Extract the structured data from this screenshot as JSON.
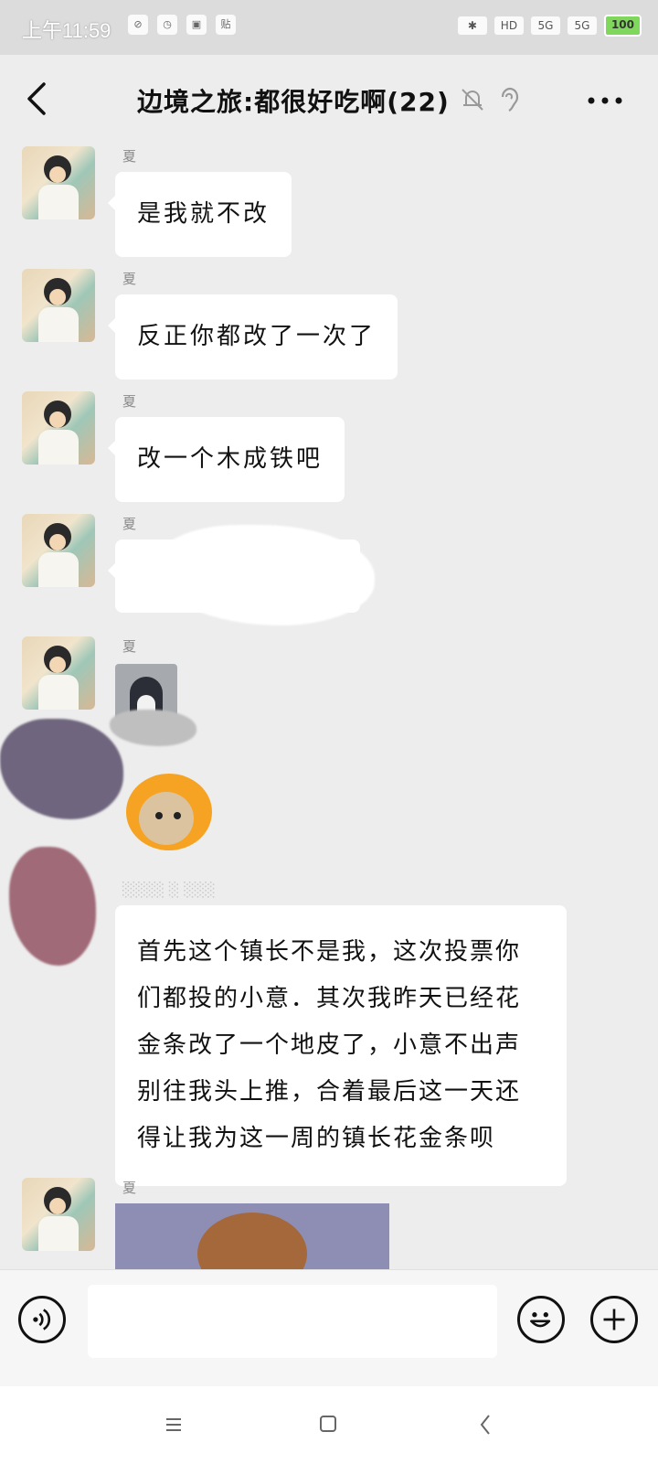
{
  "status_bar": {
    "time": "上午11:59",
    "left_icons": [
      "wifi-off-icon",
      "alarm-icon",
      "app-icon",
      "sticky-icon"
    ],
    "left_icon_text": [
      "⊘",
      "◷",
      "▣",
      "贴"
    ],
    "right_labels": [
      "✱",
      "HD",
      "5G",
      "5G"
    ],
    "battery": "100"
  },
  "header": {
    "title": "边境之旅:都很好吃啊(22)"
  },
  "messages": [
    {
      "sender": "夏",
      "text": "是我就不改"
    },
    {
      "sender": "夏",
      "text": "反正你都改了一次了"
    },
    {
      "sender": "夏",
      "text": "改一个木成铁吧"
    },
    {
      "sender": "夏"
    },
    {
      "sender": "夏"
    }
  ],
  "long_message": {
    "lines": [
      "首先这个镇长不是我，这次投票你",
      "们都投的小意．其次我昨天已经花",
      "金条改了一个地皮了，小意不出声",
      "别往我头上推，合着最后这一天还",
      "得让我为这一周的镇长花金条呗"
    ]
  },
  "last_message": {
    "sender": "夏"
  },
  "input_bar": {
    "placeholder": ""
  },
  "colors": {
    "background": "#ededed",
    "bubble": "#ffffff",
    "battery": "#7fd85b"
  }
}
